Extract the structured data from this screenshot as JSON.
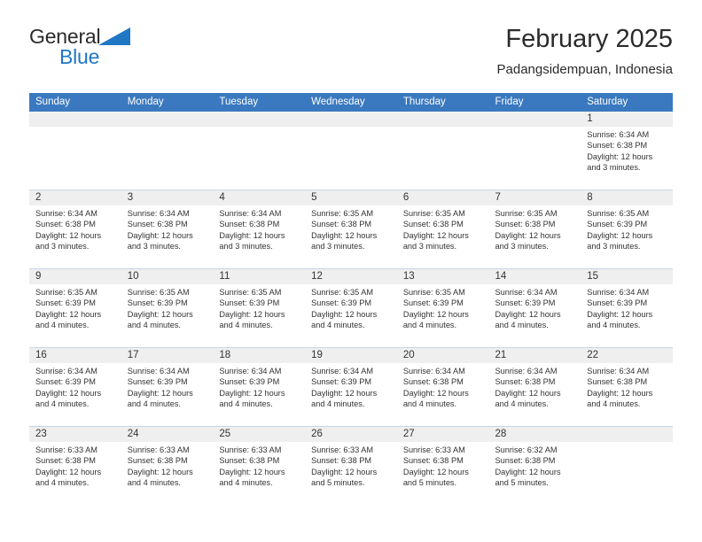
{
  "brand": {
    "name_part1": "General",
    "name_part2": "Blue",
    "triangle_color": "#2077c4"
  },
  "header": {
    "title": "February 2025",
    "location": "Padangsidempuan, Indonesia"
  },
  "theme": {
    "header_blue": "#3a79bf",
    "daystrip_gray": "#efefef",
    "text_dark": "#333333"
  },
  "weekdays": [
    "Sunday",
    "Monday",
    "Tuesday",
    "Wednesday",
    "Thursday",
    "Friday",
    "Saturday"
  ],
  "labels": {
    "sunrise_prefix": "Sunrise:",
    "sunset_prefix": "Sunset:",
    "daylight_prefix": "Daylight:"
  },
  "weeks": [
    [
      {
        "day": "",
        "sunrise": "",
        "sunset": "",
        "daylight": ""
      },
      {
        "day": "",
        "sunrise": "",
        "sunset": "",
        "daylight": ""
      },
      {
        "day": "",
        "sunrise": "",
        "sunset": "",
        "daylight": ""
      },
      {
        "day": "",
        "sunrise": "",
        "sunset": "",
        "daylight": ""
      },
      {
        "day": "",
        "sunrise": "",
        "sunset": "",
        "daylight": ""
      },
      {
        "day": "",
        "sunrise": "",
        "sunset": "",
        "daylight": ""
      },
      {
        "day": "1",
        "sunrise": "Sunrise: 6:34 AM",
        "sunset": "Sunset: 6:38 PM",
        "daylight": "Daylight: 12 hours and 3 minutes."
      }
    ],
    [
      {
        "day": "2",
        "sunrise": "Sunrise: 6:34 AM",
        "sunset": "Sunset: 6:38 PM",
        "daylight": "Daylight: 12 hours and 3 minutes."
      },
      {
        "day": "3",
        "sunrise": "Sunrise: 6:34 AM",
        "sunset": "Sunset: 6:38 PM",
        "daylight": "Daylight: 12 hours and 3 minutes."
      },
      {
        "day": "4",
        "sunrise": "Sunrise: 6:34 AM",
        "sunset": "Sunset: 6:38 PM",
        "daylight": "Daylight: 12 hours and 3 minutes."
      },
      {
        "day": "5",
        "sunrise": "Sunrise: 6:35 AM",
        "sunset": "Sunset: 6:38 PM",
        "daylight": "Daylight: 12 hours and 3 minutes."
      },
      {
        "day": "6",
        "sunrise": "Sunrise: 6:35 AM",
        "sunset": "Sunset: 6:38 PM",
        "daylight": "Daylight: 12 hours and 3 minutes."
      },
      {
        "day": "7",
        "sunrise": "Sunrise: 6:35 AM",
        "sunset": "Sunset: 6:38 PM",
        "daylight": "Daylight: 12 hours and 3 minutes."
      },
      {
        "day": "8",
        "sunrise": "Sunrise: 6:35 AM",
        "sunset": "Sunset: 6:39 PM",
        "daylight": "Daylight: 12 hours and 3 minutes."
      }
    ],
    [
      {
        "day": "9",
        "sunrise": "Sunrise: 6:35 AM",
        "sunset": "Sunset: 6:39 PM",
        "daylight": "Daylight: 12 hours and 4 minutes."
      },
      {
        "day": "10",
        "sunrise": "Sunrise: 6:35 AM",
        "sunset": "Sunset: 6:39 PM",
        "daylight": "Daylight: 12 hours and 4 minutes."
      },
      {
        "day": "11",
        "sunrise": "Sunrise: 6:35 AM",
        "sunset": "Sunset: 6:39 PM",
        "daylight": "Daylight: 12 hours and 4 minutes."
      },
      {
        "day": "12",
        "sunrise": "Sunrise: 6:35 AM",
        "sunset": "Sunset: 6:39 PM",
        "daylight": "Daylight: 12 hours and 4 minutes."
      },
      {
        "day": "13",
        "sunrise": "Sunrise: 6:35 AM",
        "sunset": "Sunset: 6:39 PM",
        "daylight": "Daylight: 12 hours and 4 minutes."
      },
      {
        "day": "14",
        "sunrise": "Sunrise: 6:34 AM",
        "sunset": "Sunset: 6:39 PM",
        "daylight": "Daylight: 12 hours and 4 minutes."
      },
      {
        "day": "15",
        "sunrise": "Sunrise: 6:34 AM",
        "sunset": "Sunset: 6:39 PM",
        "daylight": "Daylight: 12 hours and 4 minutes."
      }
    ],
    [
      {
        "day": "16",
        "sunrise": "Sunrise: 6:34 AM",
        "sunset": "Sunset: 6:39 PM",
        "daylight": "Daylight: 12 hours and 4 minutes."
      },
      {
        "day": "17",
        "sunrise": "Sunrise: 6:34 AM",
        "sunset": "Sunset: 6:39 PM",
        "daylight": "Daylight: 12 hours and 4 minutes."
      },
      {
        "day": "18",
        "sunrise": "Sunrise: 6:34 AM",
        "sunset": "Sunset: 6:39 PM",
        "daylight": "Daylight: 12 hours and 4 minutes."
      },
      {
        "day": "19",
        "sunrise": "Sunrise: 6:34 AM",
        "sunset": "Sunset: 6:39 PM",
        "daylight": "Daylight: 12 hours and 4 minutes."
      },
      {
        "day": "20",
        "sunrise": "Sunrise: 6:34 AM",
        "sunset": "Sunset: 6:38 PM",
        "daylight": "Daylight: 12 hours and 4 minutes."
      },
      {
        "day": "21",
        "sunrise": "Sunrise: 6:34 AM",
        "sunset": "Sunset: 6:38 PM",
        "daylight": "Daylight: 12 hours and 4 minutes."
      },
      {
        "day": "22",
        "sunrise": "Sunrise: 6:34 AM",
        "sunset": "Sunset: 6:38 PM",
        "daylight": "Daylight: 12 hours and 4 minutes."
      }
    ],
    [
      {
        "day": "23",
        "sunrise": "Sunrise: 6:33 AM",
        "sunset": "Sunset: 6:38 PM",
        "daylight": "Daylight: 12 hours and 4 minutes."
      },
      {
        "day": "24",
        "sunrise": "Sunrise: 6:33 AM",
        "sunset": "Sunset: 6:38 PM",
        "daylight": "Daylight: 12 hours and 4 minutes."
      },
      {
        "day": "25",
        "sunrise": "Sunrise: 6:33 AM",
        "sunset": "Sunset: 6:38 PM",
        "daylight": "Daylight: 12 hours and 4 minutes."
      },
      {
        "day": "26",
        "sunrise": "Sunrise: 6:33 AM",
        "sunset": "Sunset: 6:38 PM",
        "daylight": "Daylight: 12 hours and 5 minutes."
      },
      {
        "day": "27",
        "sunrise": "Sunrise: 6:33 AM",
        "sunset": "Sunset: 6:38 PM",
        "daylight": "Daylight: 12 hours and 5 minutes."
      },
      {
        "day": "28",
        "sunrise": "Sunrise: 6:32 AM",
        "sunset": "Sunset: 6:38 PM",
        "daylight": "Daylight: 12 hours and 5 minutes."
      },
      {
        "day": "",
        "sunrise": "",
        "sunset": "",
        "daylight": ""
      }
    ]
  ]
}
